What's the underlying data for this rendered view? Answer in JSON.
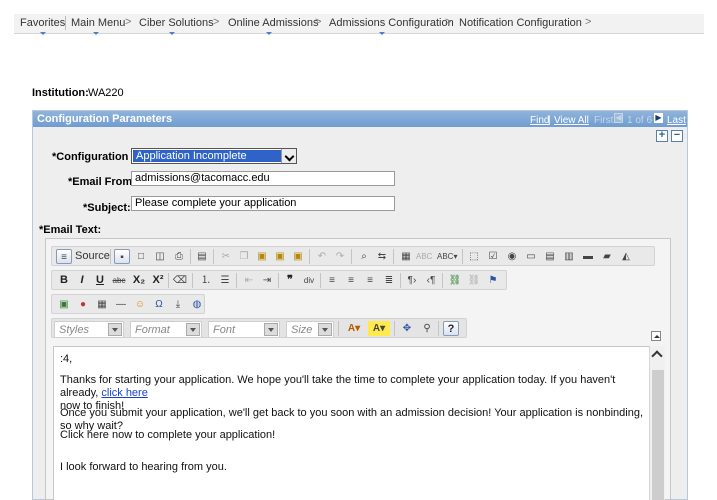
{
  "nav": {
    "items": [
      {
        "label": "Favorites"
      },
      {
        "label": "Main Menu"
      },
      {
        "label": "Ciber Solutions"
      },
      {
        "label": "Online Admissions"
      },
      {
        "label": "Admissions Configuration"
      },
      {
        "label": "Notification Configuration"
      }
    ],
    "separator": ">"
  },
  "institution": {
    "label": "Institution:",
    "value": "WA220"
  },
  "panel": {
    "title": "Configuration Parameters",
    "find": "Find",
    "view_all": "View All",
    "first": "First",
    "range": "1 of 6",
    "last": "Last",
    "add_icon": "+",
    "remove_icon": "−"
  },
  "form": {
    "config_id_label": "*Configuration Id:",
    "config_id_value": "Application Incomplete",
    "email_from_label": "*Email From:",
    "email_from_value": "admissions@tacomacc.edu",
    "subject_label": "*Subject:",
    "subject_value": "Please complete your application",
    "email_text_label": "*Email Text:"
  },
  "editor": {
    "source_label": "Source",
    "styles": "Styles",
    "format": "Format",
    "font": "Font",
    "size": "Size",
    "bold": "B",
    "italic": "I",
    "underline": "U",
    "strike": "abc",
    "subscript": "X₂",
    "superscript": "X²",
    "omega": "Ω",
    "help": "?",
    "content": {
      "line1": ":4,",
      "line2a": "Thanks for starting your application.  We hope you'll take the time to complete your application today. If you haven't already, ",
      "line2_link": "click here",
      "line2b": "now to finish!",
      "line3": "Once you submit your application, we'll get back to you soon with an admission decision! Your application is nonbinding, so why wait?",
      "line4": "Click here now to complete your application!",
      "line5": "I look forward to hearing from you."
    }
  },
  "colors": {
    "panel_header": "#7ba6d6",
    "select_highlight": "#2f63c8",
    "link": "#1a3fd0"
  }
}
